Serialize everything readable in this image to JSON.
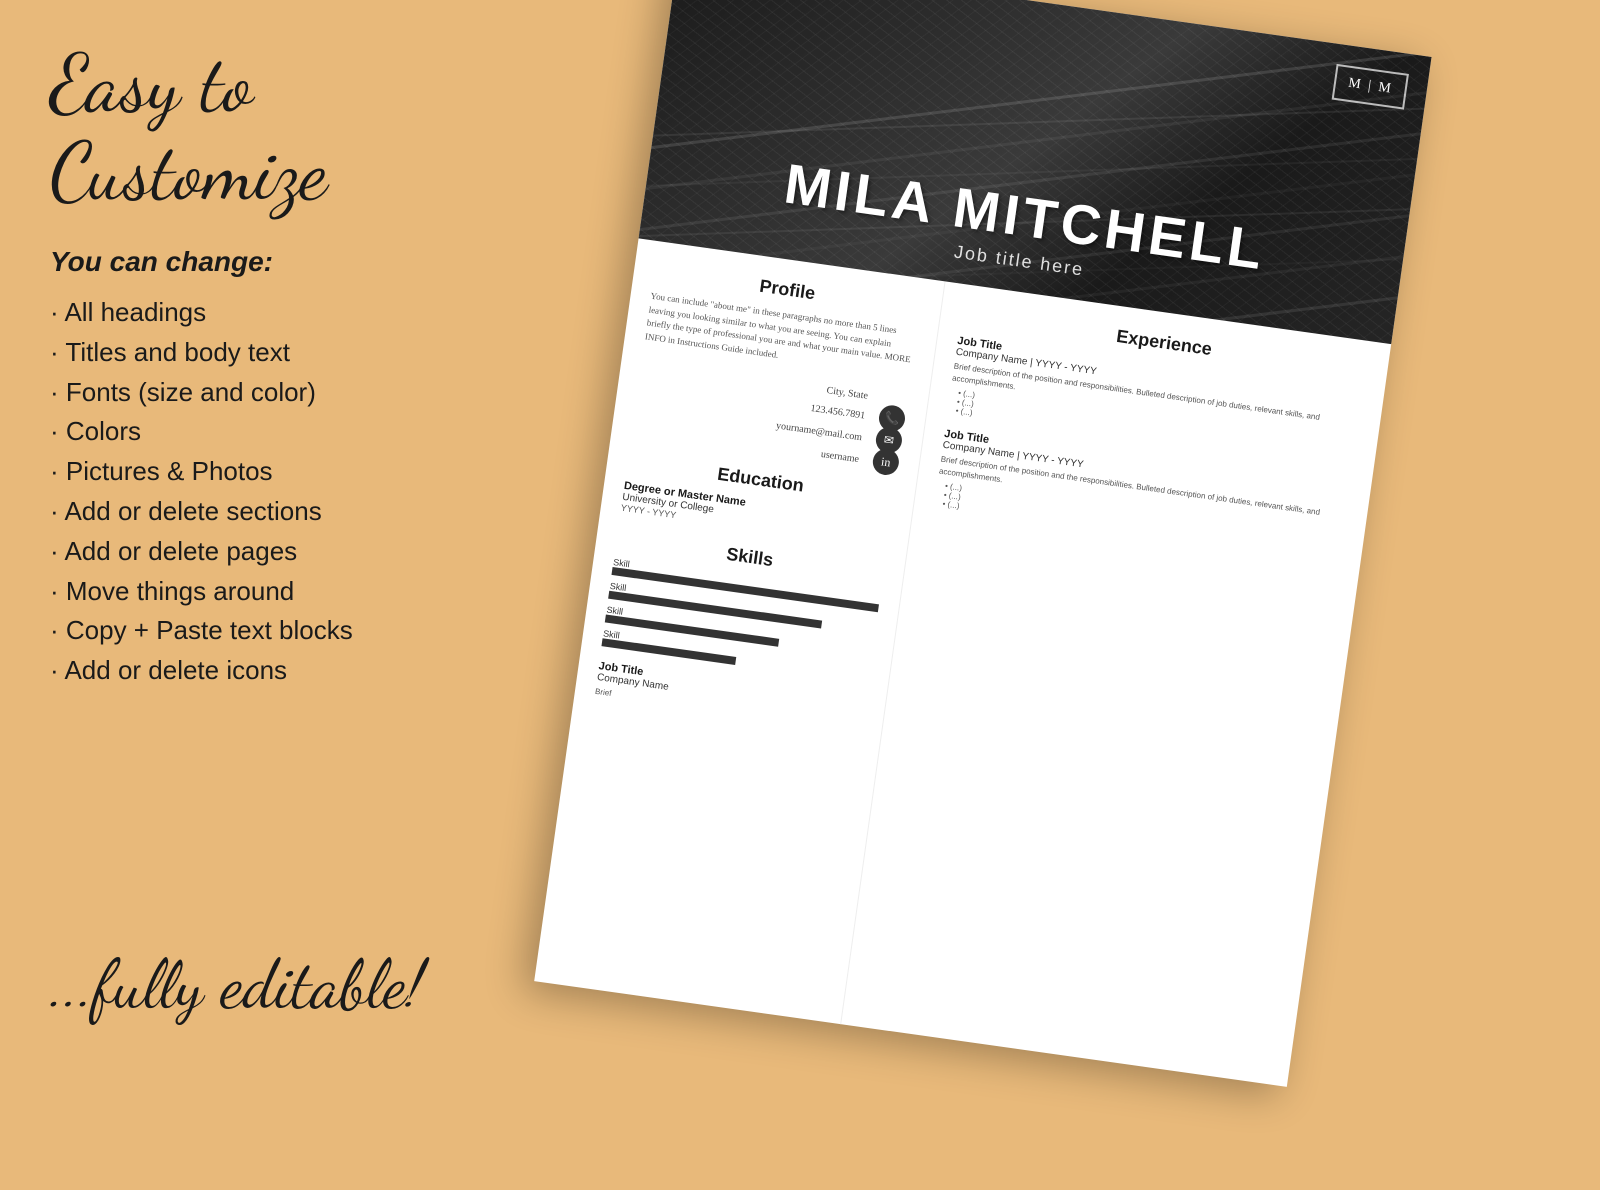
{
  "left": {
    "main_title": "Easy to Customize",
    "subtitle": "You can change:",
    "features": [
      "All headings",
      "Titles and body text",
      "Fonts (size and color)",
      "Colors",
      "Pictures & Photos",
      "Add or delete sections",
      "Add or delete pages",
      "Move things around",
      "Copy + Paste text blocks",
      "Add or delete icons"
    ],
    "footer": "...fully editable!"
  },
  "resume": {
    "name": "MILA MITCHELL",
    "title": "Job title here",
    "logo": "M | M",
    "profile": {
      "heading": "Profile",
      "text": "You can include \"about me\" in these paragraphs no more than 5 lines leaving you looking similar to what you are seeing. You can explain briefly the type of professional you are and what your main value. MORE INFO in Instructions Guide included."
    },
    "contact": {
      "city": "City, State",
      "phone": "123.456.7891",
      "email": "yourname@mail.com",
      "username": "username"
    },
    "education": {
      "heading": "Education",
      "degree": "Degree or Master Name",
      "school": "University or College",
      "year": "YYYY - YYYY"
    },
    "skills": {
      "heading": "Skills",
      "items": [
        "Skill",
        "Skill",
        "Skill",
        "Skill"
      ],
      "levels": [
        5,
        4,
        3,
        2
      ]
    },
    "experience": {
      "heading": "Experience",
      "jobs": [
        {
          "title": "Job Title",
          "company": "Company Name | YYYY - YYYY",
          "desc": "Brief description of the position and responsibilities. Bulleted description of job duties, relevant skills, and accomplishments.",
          "bullets": [
            "(...)",
            "(...)",
            "(...)"
          ]
        },
        {
          "title": "Job Title",
          "company": "Company Name | YYYY - YYYY",
          "desc": "Brief description of the position and the responsibilities. Bulleted description of job duties, relevant skills, and accomplishments.",
          "bullets": [
            "(...)",
            "(...)",
            "(...)"
          ]
        },
        {
          "title": "Job Title",
          "company": "Company Name",
          "desc": "Brief"
        }
      ]
    }
  }
}
